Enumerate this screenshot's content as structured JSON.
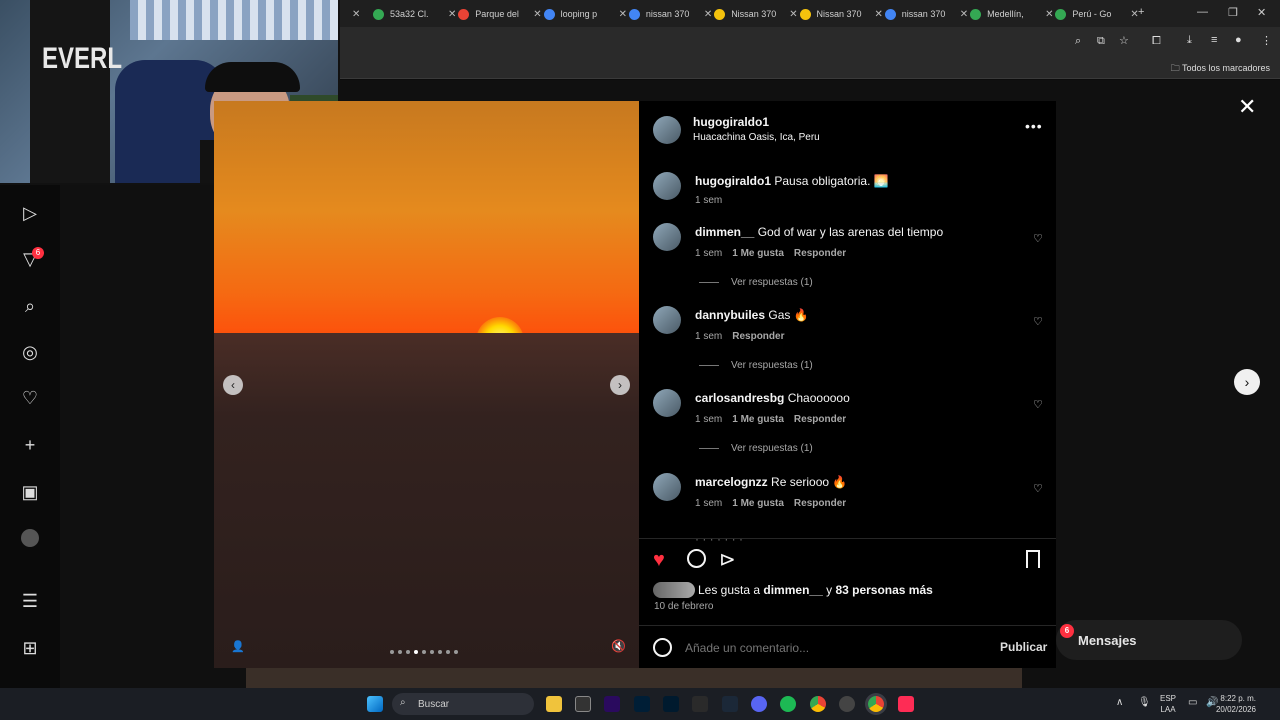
{
  "browser": {
    "tabs": [
      {
        "label": "53a32 Cl.",
        "color": "#34a853"
      },
      {
        "label": "Parque del",
        "color": "#ea4335"
      },
      {
        "label": "looping p",
        "color": "#4285f4"
      },
      {
        "label": "nissan 370",
        "color": "#4285f4"
      },
      {
        "label": "Nissan 370",
        "color": "#f4c20d"
      },
      {
        "label": "Nissan 370",
        "color": "#f4c20d"
      },
      {
        "label": "nissan 370",
        "color": "#4285f4"
      },
      {
        "label": "Medellín,",
        "color": "#34a853"
      },
      {
        "label": "Perú - Go",
        "color": "#34a853"
      }
    ],
    "bookmarks_label": "Todos los marcadores"
  },
  "post": {
    "author": "hugogiraldo1",
    "location": "Huacachina Oasis, Ica, Peru",
    "caption_user": "hugogiraldo1",
    "caption_text": "Pausa obligatoria. 🌅",
    "caption_time": "1 sem",
    "comments": [
      {
        "user": "dimmen__",
        "text": "God of war y las arenas del tiempo",
        "time": "1 sem",
        "likes": "1 Me gusta",
        "reply": "Responder",
        "replies": "Ver respuestas (1)"
      },
      {
        "user": "dannybuiles",
        "text": "Gas 🔥",
        "time": "1 sem",
        "likes": "",
        "reply": "Responder",
        "replies": "Ver respuestas (1)"
      },
      {
        "user": "carlosandresbg",
        "text": "Chaoooooo",
        "time": "1 sem",
        "likes": "1 Me gusta",
        "reply": "Responder",
        "replies": "Ver respuestas (1)"
      },
      {
        "user": "marcelognzz",
        "text": "Re seriooo 🔥",
        "time": "1 sem",
        "likes": "1 Me gusta",
        "reply": "Responder",
        "replies": ""
      }
    ],
    "likes_prefix": "Les gusta a",
    "likes_user": "dimmen__",
    "likes_join": "y",
    "likes_rest": "83 personas más",
    "date": "10 de febrero",
    "comment_placeholder": "Añade un comentario...",
    "publish_label": "Publicar",
    "carousel_active": 3,
    "carousel_count": 9
  },
  "overlay": {
    "messages_label": "Mensajes",
    "messages_badge": "6",
    "notif_badge": "6"
  },
  "taskbar": {
    "search_label": "Buscar",
    "lang_top": "ESP",
    "lang_bottom": "LAA",
    "time": "8:22 p. m.",
    "date": "20/02/2026"
  },
  "webcam": {
    "bag_text": "EVERL"
  }
}
